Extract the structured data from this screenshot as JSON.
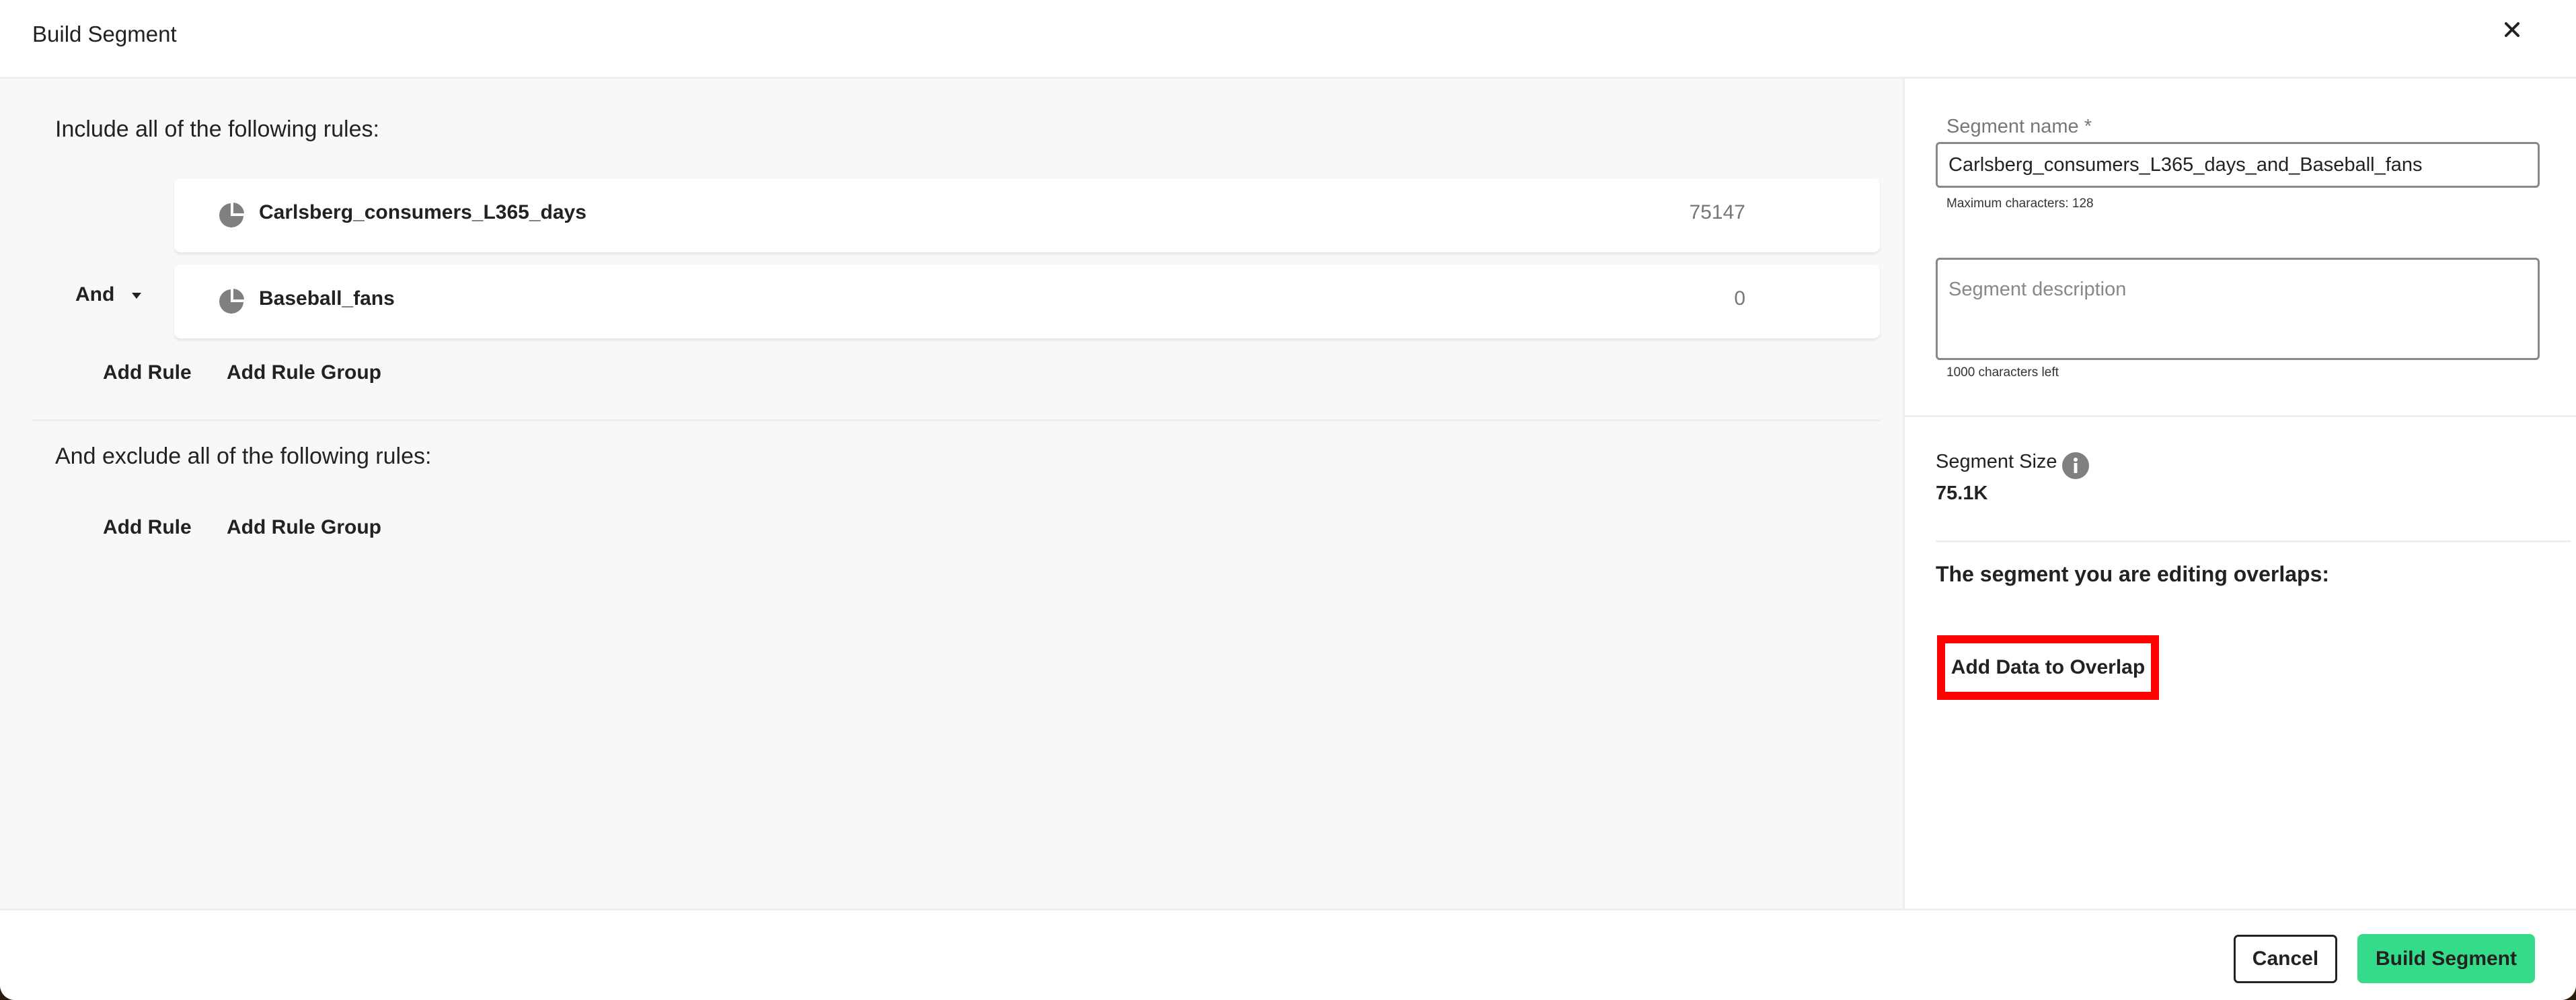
{
  "header": {
    "title": "Build Segment",
    "close_icon": "close-icon"
  },
  "include": {
    "heading": "Include all of the following rules:",
    "combinator": "And",
    "rules": [
      {
        "icon": "pie-chart-icon",
        "name": "Carlsberg_consumers_L365_days",
        "count": "75147"
      },
      {
        "icon": "pie-chart-icon",
        "name": "Baseball_fans",
        "count": "0"
      }
    ],
    "add_rule_label": "Add Rule",
    "add_rule_group_label": "Add Rule Group"
  },
  "exclude": {
    "heading": "And exclude all of the following rules:",
    "add_rule_label": "Add Rule",
    "add_rule_group_label": "Add Rule Group"
  },
  "panel": {
    "name_label": "Segment name *",
    "name_value": "Carlsberg_consumers_L365_days_and_Baseball_fans",
    "name_helper": "Maximum characters: 128",
    "description_placeholder": "Segment description",
    "description_value": "",
    "description_helper": "1000 characters left",
    "size_label": "Segment Size",
    "size_info_icon": "info-icon",
    "size_value": "75.1K",
    "overlap_title": "The segment you are editing overlaps:",
    "overlap_button_label": "Add Data to Overlap",
    "highlight_color": "#ff0000"
  },
  "footer": {
    "cancel_label": "Cancel",
    "build_label": "Build Segment",
    "build_color": "#34db89"
  }
}
